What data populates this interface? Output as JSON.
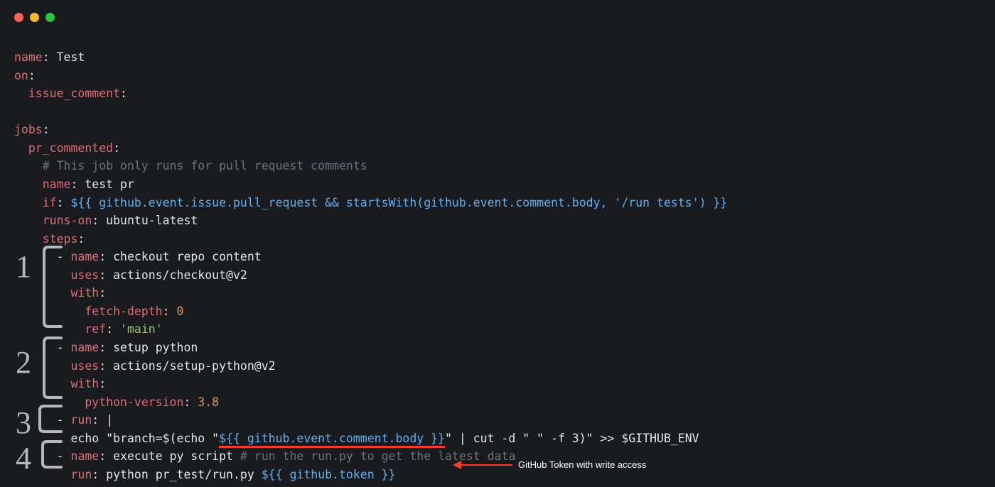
{
  "workflow": {
    "name_key": "name",
    "name_val": "Test",
    "on_key": "on",
    "issue_comment_key": "issue_comment",
    "jobs_key": "jobs",
    "pr_commented_key": "pr_commented",
    "comment1": "# This job only runs for pull request comments",
    "job_name_key": "name",
    "job_name_val": "test pr",
    "if_key": "if",
    "if_expr": "${{ github.event.issue.pull_request && startsWith(github.event.comment.body, '/run tests') }}",
    "runs_on_key": "runs-on",
    "runs_on_val": "ubuntu-latest",
    "steps_key": "steps"
  },
  "steps": {
    "s1_name": "checkout repo content",
    "s1_uses": "actions/checkout@v2",
    "s1_fetch_depth": "0",
    "s1_ref": "'main'",
    "s2_name": "setup python",
    "s2_uses": "actions/setup-python@v2",
    "s2_pyver": "3.8",
    "s3_run_pipe": "|",
    "s3_echo_prefix": "echo \"branch=$(echo \"",
    "s3_expr": "${{ github.event.comment.body }}",
    "s3_echo_suffix": "\" | cut -d \" \" -f 3)\" >> $GITHUB_ENV",
    "s4_name": "execute py script",
    "s4_comment": "# run the run.py to get the latest data",
    "s4_run_prefix": "python pr_test/run.py ",
    "s4_expr": "${{ github.token }}"
  },
  "keys": {
    "name": "name",
    "uses": "uses",
    "with": "with",
    "fetch_depth": "fetch-depth",
    "ref": "ref",
    "python_version": "python-version",
    "run": "run"
  },
  "annotations": {
    "n1": "1",
    "n2": "2",
    "n3": "3",
    "n4": "4",
    "arrow_label": "GitHub Token with write access"
  }
}
